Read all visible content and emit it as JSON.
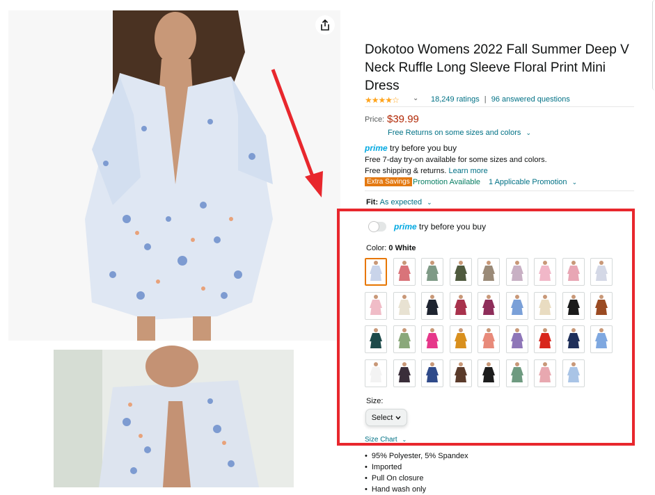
{
  "product": {
    "title": "Dokotoo Womens 2022 Fall Summer Deep V Neck Ruffle Long Sleeve Floral Print Mini Dress",
    "stars": "★★★★☆",
    "rating_value": 4.2,
    "ratings_count": "18,249 ratings",
    "separator": "|",
    "answered": "96 answered questions",
    "price_label": "Price:",
    "price": "$39.99",
    "free_returns": "Free Returns on some sizes and colors",
    "prime_word": "prime",
    "prime_tagline": "try before you buy",
    "prime_line1": "Free 7-day try-on available for some sizes and colors.",
    "prime_line2_prefix": "Free shipping & returns.",
    "learn_more": "Learn more",
    "extra_savings": "Extra Savings",
    "promotion_available": "Promotion Available",
    "applicable_promotion": "1 Applicable Promotion",
    "fit_label": "Fit:",
    "fit_value": "As expected"
  },
  "variation": {
    "prime_toggle_word": "prime",
    "prime_toggle_text": "try before you buy",
    "color_label": "Color:",
    "color_value": "0 White",
    "swatches": [
      "#c9d4ea",
      "#d9747a",
      "#7e9a86",
      "#4f5a3e",
      "#9a8a78",
      "#c8b0c4",
      "#f1b7c8",
      "#e8a6b4",
      "#d4d8e6",
      "#f0bcc7",
      "#e8e2d2",
      "#1e2430",
      "#a8324c",
      "#8e2e5a",
      "#7aa0d8",
      "#e9dcc1",
      "#1a1a1a",
      "#9a4a22",
      "#1d4a4a",
      "#8aa87a",
      "#e6378a",
      "#d9901e",
      "#e88a7a",
      "#8e76b8",
      "#d8261c",
      "#1f2f5a",
      "#7fa8e0",
      "#f3f3f3",
      "#3a2e3a",
      "#2f4a8a",
      "#5a3a2a",
      "#1c1c1c",
      "#6e9a80",
      "#e8a8b0",
      "#a9c4e6"
    ],
    "size_label": "Size:",
    "size_select": "Select",
    "size_chart": "Size Chart"
  },
  "bullets": [
    "95% Polyester, 5% Spandex",
    "Imported",
    "Pull On closure",
    "Hand wash only"
  ],
  "colors": {
    "highlight_box": "#e8272d",
    "price": "#b12704",
    "link": "#007185",
    "prime": "#00a8e1"
  }
}
